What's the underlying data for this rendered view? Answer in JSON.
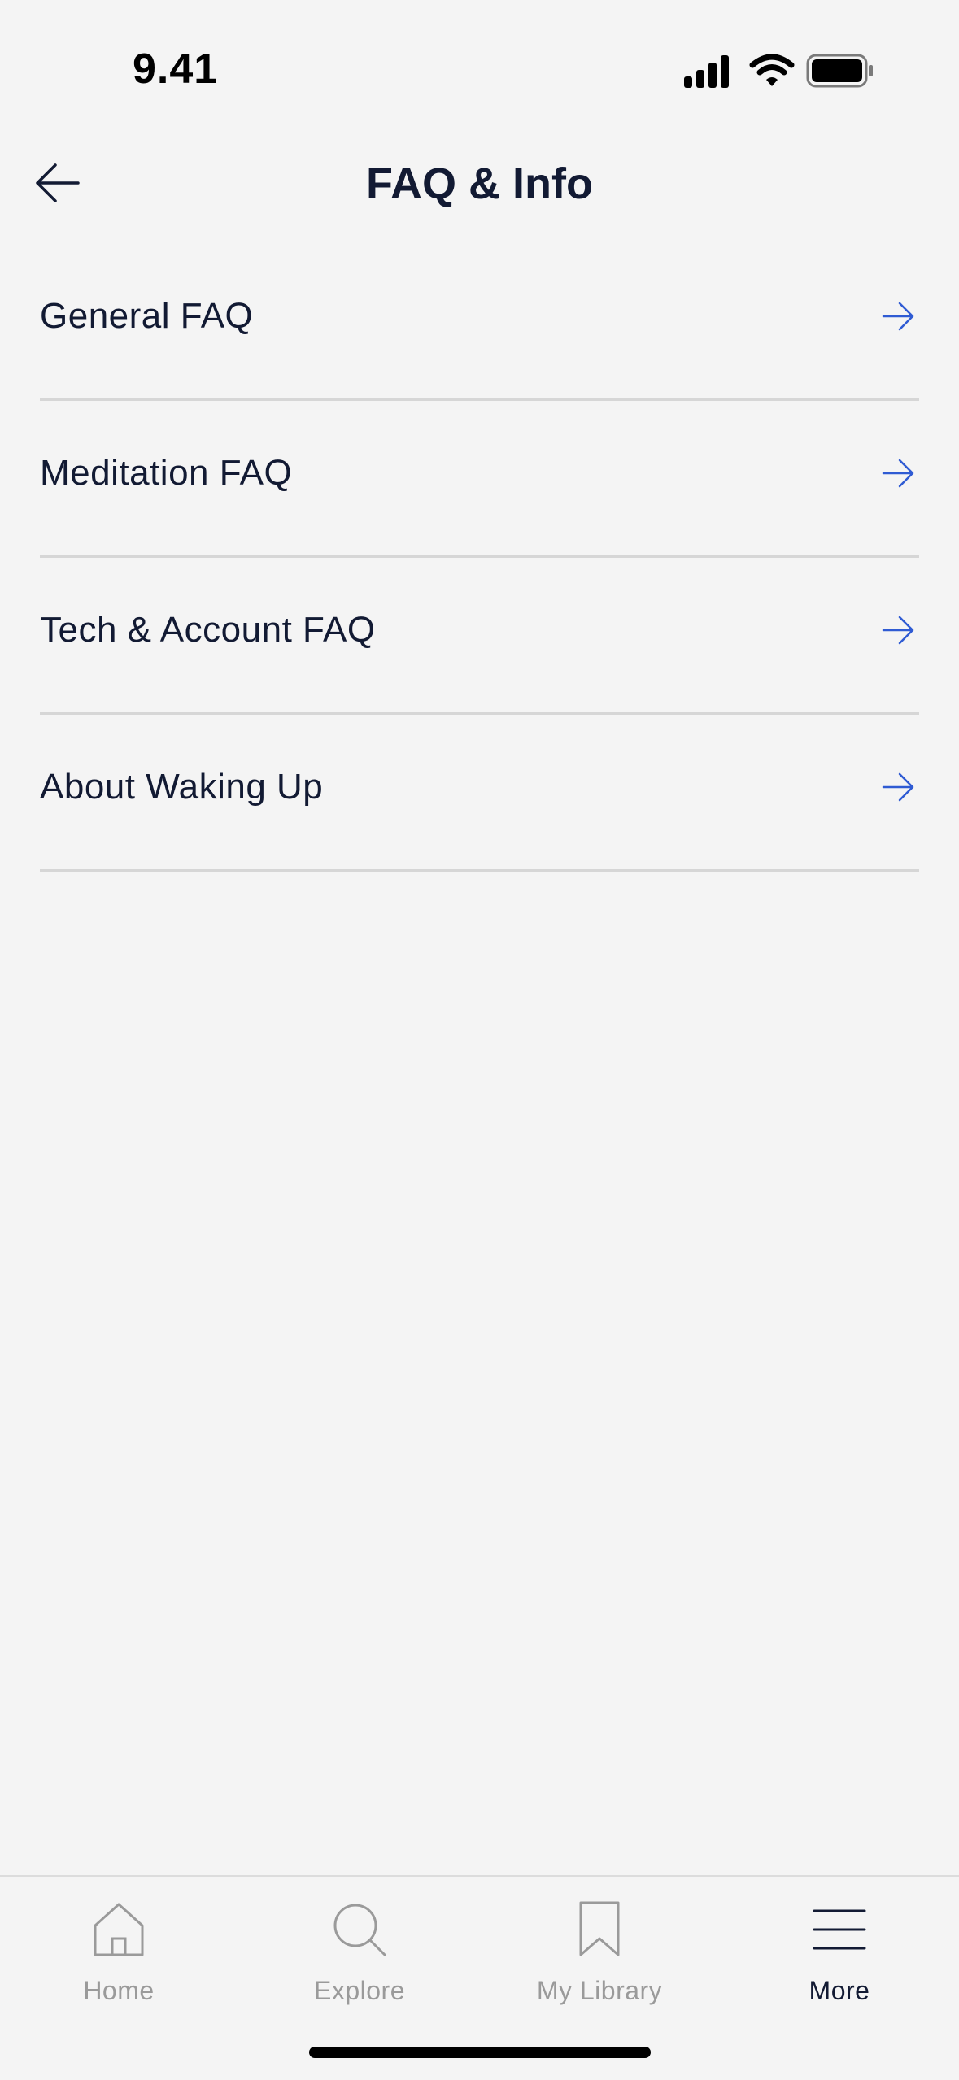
{
  "status_bar": {
    "time": "9.41"
  },
  "header": {
    "title": "FAQ & Info",
    "back_icon": "arrow-left-icon"
  },
  "faq_items": [
    {
      "label": "General FAQ",
      "icon": "arrow-right-icon"
    },
    {
      "label": "Meditation FAQ",
      "icon": "arrow-right-icon"
    },
    {
      "label": "Tech & Account FAQ",
      "icon": "arrow-right-icon"
    },
    {
      "label": "About Waking Up",
      "icon": "arrow-right-icon"
    }
  ],
  "tab_bar": {
    "tabs": [
      {
        "label": "Home",
        "icon": "home-icon",
        "active": false
      },
      {
        "label": "Explore",
        "icon": "search-icon",
        "active": false
      },
      {
        "label": "My Library",
        "icon": "bookmark-icon",
        "active": false
      },
      {
        "label": "More",
        "icon": "menu-icon",
        "active": true
      }
    ]
  },
  "colors": {
    "background": "#f4f4f4",
    "text_primary": "#121a33",
    "accent_arrow": "#2f5bd3",
    "tab_inactive": "#9a9a9a",
    "divider": "#d6d6d6"
  }
}
